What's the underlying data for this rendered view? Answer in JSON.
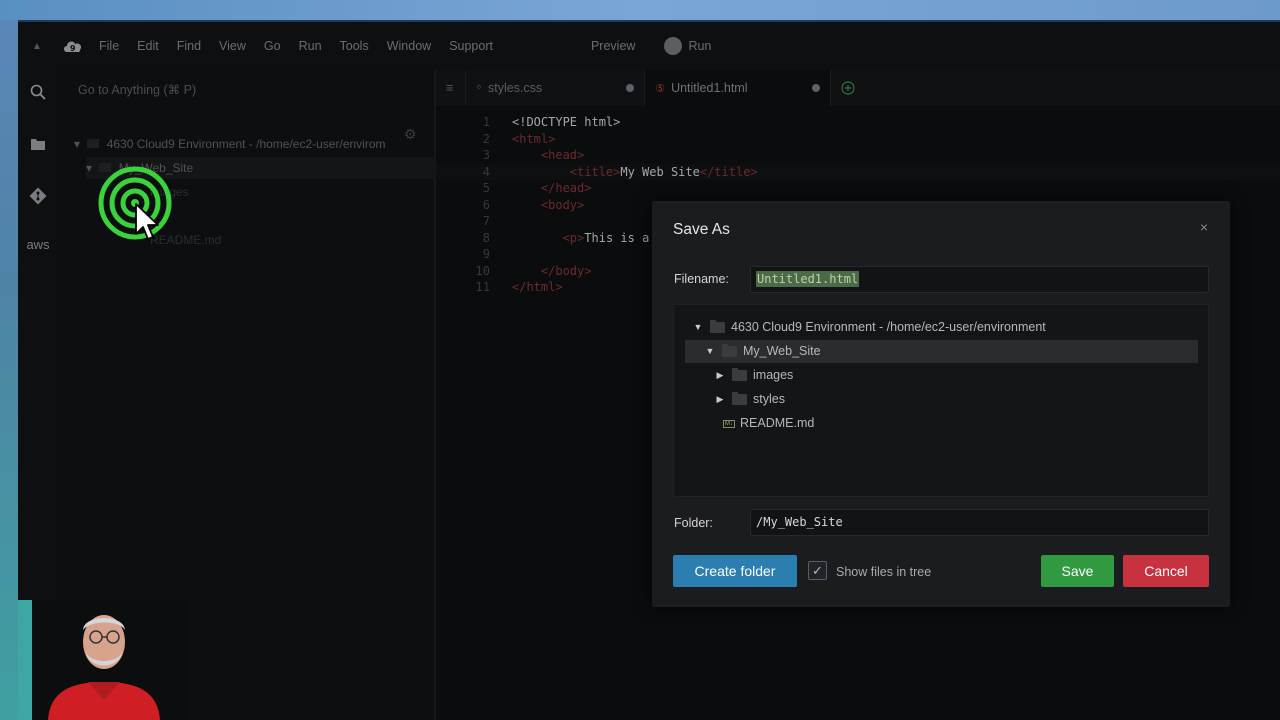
{
  "menubar": {
    "items": [
      "File",
      "Edit",
      "Find",
      "View",
      "Go",
      "Run",
      "Tools",
      "Window",
      "Support"
    ],
    "preview_label": "Preview",
    "run_label": "Run"
  },
  "sidebar": {
    "icons": [
      "search-icon",
      "folder-icon",
      "git-icon",
      "aws-icon"
    ],
    "aws_label": "aws"
  },
  "file_tree": {
    "goto_placeholder": "Go to Anything (⌘ P)",
    "root_label": "4630 Cloud9 Environment - /home/ec2-user/envirom",
    "folder_label": "My_Web_Site",
    "child1": "images",
    "child2": "README.md"
  },
  "tabs": [
    {
      "label": "styles.css",
      "icon": "css-icon",
      "modified": true
    },
    {
      "label": "Untitled1.html",
      "icon": "html-icon",
      "modified": true
    }
  ],
  "code": {
    "line_numbers": [
      "1",
      "2",
      "3",
      "4",
      "5",
      "6",
      "7",
      "8",
      "9",
      "10",
      "11"
    ],
    "lines": [
      [
        "",
        "<!DOCTYPE html>",
        ""
      ],
      [
        "",
        "<html>",
        ""
      ],
      [
        "    ",
        "<head>",
        ""
      ],
      [
        "        ",
        "<title>",
        "My Web Site",
        "</title>"
      ],
      [
        "    ",
        "</head>",
        ""
      ],
      [
        "    ",
        "<body>",
        ""
      ],
      [
        "",
        "",
        ""
      ],
      [
        "       ",
        "<p>",
        "This is a pa"
      ],
      [
        "",
        "",
        ""
      ],
      [
        "    ",
        "</body>",
        ""
      ],
      [
        "",
        "</html>",
        ""
      ]
    ]
  },
  "dialog": {
    "title": "Save As",
    "close_label": "×",
    "filename_label": "Filename:",
    "filename_value": "Untitled1.html",
    "tree": {
      "root": "4630 Cloud9 Environment - /home/ec2-user/environment",
      "folder": "My_Web_Site",
      "items": [
        "images",
        "styles"
      ],
      "file": "README.md"
    },
    "folder_label": "Folder:",
    "folder_value": "/My_Web_Site",
    "create_folder_label": "Create folder",
    "show_files_label": "Show files in tree",
    "show_files_checked": "✓",
    "save_label": "Save",
    "cancel_label": "Cancel"
  },
  "colors": {
    "create_button": "#2a7fb0",
    "save_button": "#2f9a3f",
    "cancel_button": "#c8323f",
    "click_indicator": "#3bd33b"
  }
}
